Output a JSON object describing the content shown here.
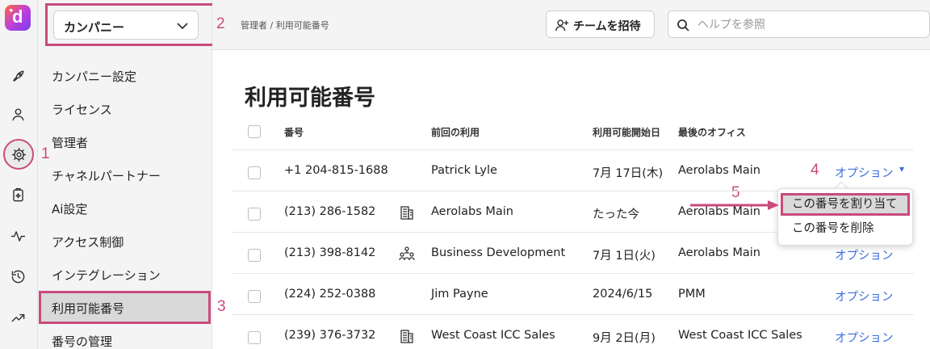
{
  "app": {
    "logo_letter": "d"
  },
  "rail": {
    "icons": [
      "rocket-icon",
      "user-icon",
      "gear-icon",
      "clipboard-sparkle-icon",
      "activity-icon",
      "history-icon",
      "trending-icon"
    ],
    "active": "gear-icon"
  },
  "sidebar": {
    "company_select": "カンパニー",
    "items": [
      {
        "label": "カンパニー設定"
      },
      {
        "label": "ライセンス"
      },
      {
        "label": "管理者"
      },
      {
        "label": "チャネルパートナー"
      },
      {
        "label": "Ai設定"
      },
      {
        "label": "アクセス制御"
      },
      {
        "label": "インテグレーション"
      },
      {
        "label": "利用可能番号"
      },
      {
        "label": "番号の管理"
      }
    ],
    "selected_index": 7
  },
  "topbar": {
    "breadcrumb": "管理者 / 利用可能番号",
    "invite_label": "チームを招待",
    "search_placeholder": "ヘルプを参照"
  },
  "annotations": [
    "1",
    "2",
    "3",
    "4",
    "5"
  ],
  "main": {
    "title": "利用可能番号",
    "columns": [
      "番号",
      "前回の利用",
      "利用可能開始日",
      "最後のオフィス"
    ],
    "option_label": "オプション",
    "rows": [
      {
        "number": "+1 204-815-1688",
        "icon": "",
        "previous": "Patrick Lyle",
        "since": "7月 17日(木)",
        "office": "Aerolabs Main"
      },
      {
        "number": "(213) 286-1582",
        "icon": "office-building-icon",
        "previous": "Aerolabs Main",
        "since": "たった今",
        "office": "Aerolabs Main"
      },
      {
        "number": "(213) 398-8142",
        "icon": "team-group-icon",
        "previous": "Business Development",
        "since": "7月 1日(火)",
        "office": "Aerolabs Main"
      },
      {
        "number": "(224) 252-0388",
        "icon": "",
        "previous": "Jim Payne",
        "since": "2024/6/15",
        "office": "PMM"
      },
      {
        "number": "(239) 376-3732",
        "icon": "office-building-icon",
        "previous": "West Coast ICC Sales",
        "since": "9月 2日(月)",
        "office": "West Coast ICC Sales"
      }
    ]
  },
  "menu": {
    "items": [
      {
        "label": "この番号を割り当て"
      },
      {
        "label": "この番号を削除"
      }
    ]
  },
  "colors": {
    "annotation": "#c94a7d",
    "link": "#3b6fe0",
    "selected_bg": "#d9d9d9"
  }
}
